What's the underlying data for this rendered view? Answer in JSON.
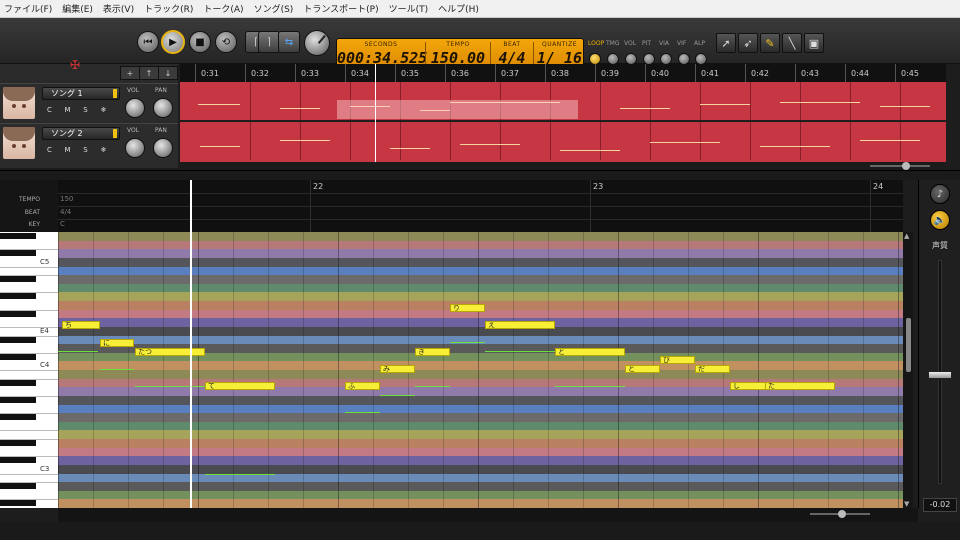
{
  "menu": [
    "ファイル(F)",
    "編集(E)",
    "表示(V)",
    "トラック(R)",
    "トーク(A)",
    "ソング(S)",
    "トランスポート(P)",
    "ツール(T)",
    "ヘルプ(H)"
  ],
  "transport": {
    "seconds_label": "SECONDS",
    "seconds": "000:34.525",
    "tempo_label": "TEMPO",
    "tempo": "150.00",
    "beat_label": "BEAT",
    "beat": "4/4",
    "quantize_label": "QUANTIZE",
    "quantize": "1/ 16"
  },
  "mini_controls": [
    "LOOP",
    "TMG",
    "VOL",
    "PIT",
    "VIA",
    "VIF",
    "ALP"
  ],
  "track_buttons": [
    "+",
    "↑",
    "↓"
  ],
  "tracks": [
    {
      "name": "ソング 1",
      "vol_label": "VOL",
      "pan_label": "PAN",
      "btn_c": "C",
      "btn_m": "M",
      "btn_s": "S",
      "btn_star": "❄"
    },
    {
      "name": "ソング 2",
      "vol_label": "VOL",
      "pan_label": "PAN",
      "btn_c": "C",
      "btn_m": "M",
      "btn_s": "S",
      "btn_star": "❄"
    }
  ],
  "timeline": [
    "0:31",
    "0:32",
    "0:33",
    "0:34",
    "0:35",
    "0:36",
    "0:37",
    "0:38",
    "0:39",
    "0:40",
    "0:41",
    "0:42",
    "0:43",
    "0:44",
    "0:45"
  ],
  "info_labels": {
    "tempo": "TEMPO",
    "beat": "BEAT",
    "key": "KEY"
  },
  "info_values": {
    "tempo": "150",
    "beat": "4/4",
    "key": "C"
  },
  "measures": [
    "22",
    "23",
    "24"
  ],
  "piano_labels": {
    "c5": "C5",
    "e4": "E4",
    "c4": "C4",
    "c3": "C3"
  },
  "notes": [
    {
      "lyric": "ち"
    },
    {
      "lyric": "に"
    },
    {
      "lyric": "たつ"
    },
    {
      "lyric": "て"
    },
    {
      "lyric": "ふ"
    },
    {
      "lyric": "み"
    },
    {
      "lyric": "き"
    },
    {
      "lyric": "り"
    },
    {
      "lyric": "え"
    },
    {
      "lyric": "と"
    },
    {
      "lyric": "と"
    },
    {
      "lyric": "び"
    },
    {
      "lyric": "だ"
    },
    {
      "lyric": "し"
    },
    {
      "lyric": "た"
    }
  ],
  "right_panel": {
    "label": "声質",
    "value": "-0.02",
    "note_icon": "♪",
    "speaker_icon": "🔈"
  },
  "colors": {
    "accent": "#f0a800",
    "note": "#f7ef37",
    "pitch": "#6be03b",
    "track": "#c73643"
  }
}
